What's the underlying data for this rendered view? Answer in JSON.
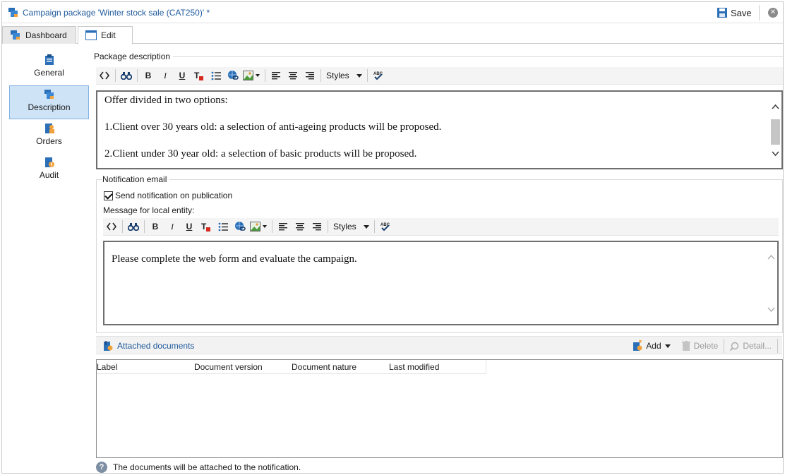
{
  "window": {
    "title": "Campaign package 'Winter stock sale (CAT250)' *",
    "save_label": "Save"
  },
  "tabs": [
    {
      "label": "Dashboard",
      "active": false
    },
    {
      "label": "Edit",
      "active": true
    }
  ],
  "sidebar": {
    "items": [
      {
        "label": "General",
        "icon": "clipboard-icon",
        "selected": false
      },
      {
        "label": "Description",
        "icon": "package-icon",
        "selected": true
      },
      {
        "label": "Orders",
        "icon": "orders-icon",
        "selected": false
      },
      {
        "label": "Audit",
        "icon": "audit-icon",
        "selected": false
      }
    ]
  },
  "package_description": {
    "label": "Package description",
    "toolbar": {
      "styles_label": "Styles"
    },
    "content": [
      "Offer divided in two options:",
      "1.Client over 30 years old: a selection of anti-ageing products will be proposed.",
      "2.Client under 30 year old: a selection of basic products will be proposed."
    ]
  },
  "notification": {
    "label": "Notification email",
    "checkbox_label": "Send notification on publication",
    "checked": true,
    "message_label": "Message for local entity:",
    "toolbar": {
      "styles_label": "Styles"
    },
    "content": "Please complete the web form and evaluate the campaign."
  },
  "attachments": {
    "title": "Attached documents",
    "actions": {
      "add": "Add",
      "delete": "Delete",
      "detail": "Detail..."
    },
    "columns": [
      "Label",
      "Document version",
      "Document nature",
      "Last modified"
    ],
    "rows": []
  },
  "footer_note": "The documents will be attached to the notification.",
  "colors": {
    "accent": "#1f5a9c",
    "selected_bg": "#cfe3f7",
    "selected_border": "#7fb0e3"
  }
}
